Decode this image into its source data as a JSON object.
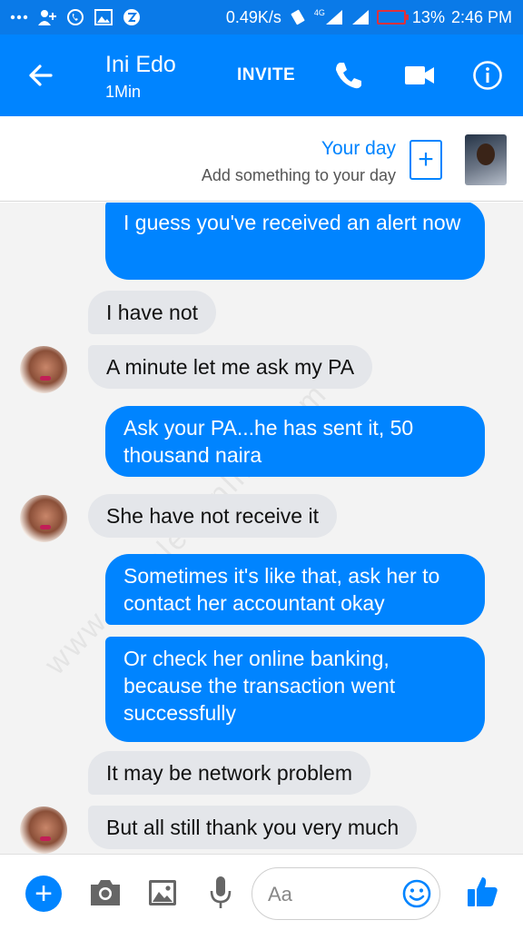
{
  "status_bar": {
    "network_speed": "0.49K/s",
    "network_type": "4G",
    "battery": "13%",
    "time": "2:46 PM",
    "icons": [
      "more-icon",
      "add-contact-icon",
      "whatsapp-icon",
      "image-icon",
      "app-icon",
      "vibrate-icon",
      "signal-icon",
      "signal-icon",
      "battery-icon"
    ]
  },
  "header": {
    "contact_name": "Ini Edo",
    "active_status": "1Min",
    "invite_label": "INVITE",
    "icons": [
      "back-arrow-icon",
      "phone-icon",
      "video-icon",
      "info-icon"
    ]
  },
  "your_day": {
    "title": "Your day",
    "subtitle": "Add something to your day",
    "add_symbol": "+"
  },
  "watermark": "www.yabaleftonline.com",
  "messages": [
    {
      "from": "me",
      "text": "I guess you've received an alert now"
    },
    {
      "from": "them",
      "text": "I have not"
    },
    {
      "from": "them",
      "text": "A minute let me ask my PA"
    },
    {
      "from": "me",
      "text": "Ask your PA...he has sent it, 50 thousand naira"
    },
    {
      "from": "them",
      "text": "She have not receive it"
    },
    {
      "from": "me",
      "text": "Sometimes it's like that, ask her to contact her accountant okay"
    },
    {
      "from": "me",
      "text": "Or check her online banking, because the transaction went successfully"
    },
    {
      "from": "them",
      "text": "It may be network problem"
    },
    {
      "from": "them",
      "text": "But all still thank you very much"
    }
  ],
  "composer": {
    "placeholder": "Aa",
    "add_symbol": "+",
    "icons": [
      "add-icon",
      "camera-icon",
      "gallery-icon",
      "microphone-icon",
      "emoji-icon",
      "thumbs-up-icon"
    ]
  },
  "colors": {
    "accent": "#0084ff",
    "status_bar": "#0a7ae8",
    "incoming_bubble": "#e4e6ea",
    "chat_background": "#f3f3f3"
  }
}
